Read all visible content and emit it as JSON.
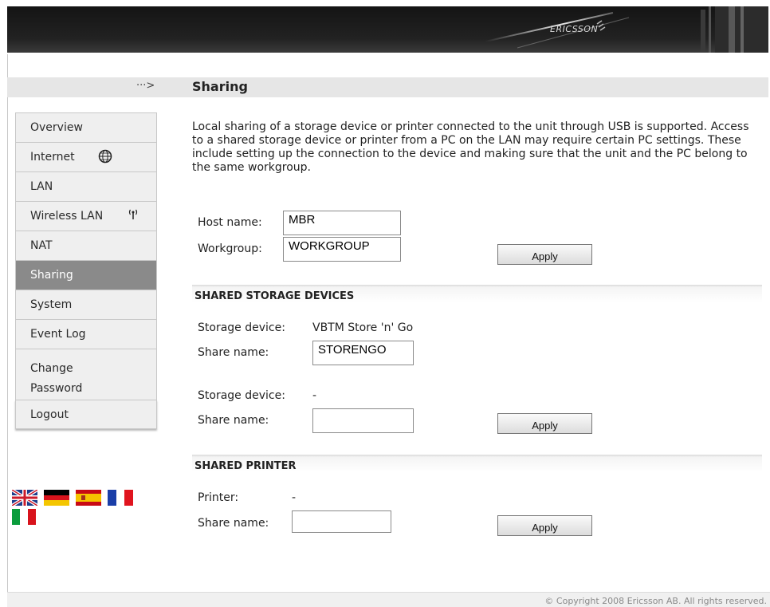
{
  "header": {
    "logo_text": "ERICSSON"
  },
  "title_bar": {
    "arrow": "···>",
    "title": "Sharing"
  },
  "sidebar": {
    "items": [
      {
        "label": "Overview"
      },
      {
        "label": "Internet",
        "icon": "globe-icon"
      },
      {
        "label": "LAN"
      },
      {
        "label": "Wireless LAN",
        "icon": "wireless-icon"
      },
      {
        "label": "NAT"
      },
      {
        "label": "Sharing",
        "active": true
      },
      {
        "label": "System"
      },
      {
        "label": "Event Log"
      },
      {
        "label_line1": "Change",
        "label_line2": "Password"
      },
      {
        "label": "Logout"
      }
    ],
    "languages": [
      "english-flag",
      "german-flag",
      "spanish-flag",
      "french-flag",
      "italian-flag"
    ]
  },
  "main": {
    "description": "Local sharing of a storage device or printer connected to the unit through USB is supported. Access to a shared storage device or printer from a PC on the LAN may require certain PC settings. These include setting up the connection to the device and making sure that the unit and the PC belong to the same workgroup.",
    "host_name": {
      "label": "Host name:",
      "value": "MBR"
    },
    "workgroup": {
      "label": "Workgroup:",
      "value": "WORKGROUP"
    },
    "apply1": "Apply",
    "storage": {
      "heading": "SHARED STORAGE DEVICES",
      "device1": {
        "label": "Storage device:",
        "value": "VBTM Store 'n' Go",
        "share_label": "Share name:",
        "share_value": "STORENGO"
      },
      "device2": {
        "label": "Storage device:",
        "value": "-",
        "share_label": "Share name:",
        "share_value": ""
      },
      "apply": "Apply"
    },
    "printer": {
      "heading": "SHARED PRINTER",
      "label": "Printer:",
      "value": "-",
      "share_label": "Share name:",
      "share_value": "",
      "apply": "Apply"
    }
  },
  "footer": {
    "copyright": "© Copyright 2008 Ericsson AB. All rights reserved."
  },
  "colors": {
    "active_nav": "#8a8a8a",
    "nav_bg": "#efefef",
    "title_band": "#e6e6e6",
    "header": "#1a1a1a"
  }
}
